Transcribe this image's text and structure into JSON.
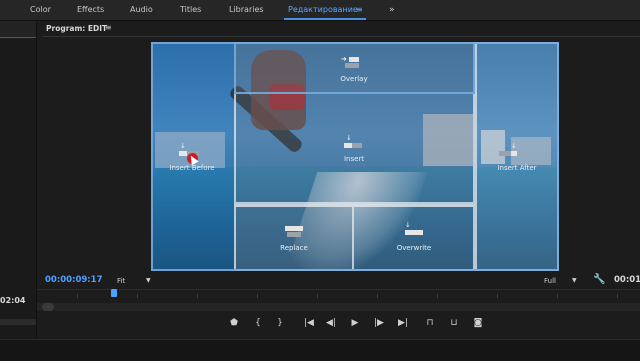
{
  "workspaces": {
    "tabs": [
      "Color",
      "Effects",
      "Audio",
      "Titles",
      "Libraries",
      "Редактирование"
    ],
    "active": "Редактирование",
    "menu_icon": "≡",
    "more_icon": "»"
  },
  "left_panel": {
    "timecode": "02:04",
    "add_icon": "+"
  },
  "program_monitor": {
    "title": "Program: EDIT",
    "menu_icon": "≡",
    "zones": {
      "overlay": "Overlay",
      "insert": "Insert",
      "insert_before": "Insert Before",
      "insert_after": "Insert After",
      "replace": "Replace",
      "overwrite": "Overwrite"
    },
    "current_timecode": "00:00:09:17",
    "fit": "Fit",
    "resolution": "Full",
    "duration_timecode": "00:01:",
    "chevron_icon": "▼",
    "settings_icon": "wrench-icon"
  },
  "transport": {
    "buttons": [
      {
        "name": "add-marker-button",
        "icon": "marker-icon",
        "glyph": "⬟"
      },
      {
        "name": "mark-in-button",
        "icon": "mark-in-icon",
        "glyph": "{"
      },
      {
        "name": "mark-out-button",
        "icon": "mark-out-icon",
        "glyph": "}"
      },
      {
        "name": "go-to-in-button",
        "icon": "go-to-in-icon",
        "glyph": "|◀"
      },
      {
        "name": "step-back-button",
        "icon": "step-back-icon",
        "glyph": "◀|"
      },
      {
        "name": "play-button",
        "icon": "play-icon",
        "glyph": "▶"
      },
      {
        "name": "step-forward-button",
        "icon": "step-forward-icon",
        "glyph": "|▶"
      },
      {
        "name": "go-to-out-button",
        "icon": "go-to-out-icon",
        "glyph": "▶|"
      },
      {
        "name": "lift-button",
        "icon": "lift-icon",
        "glyph": "⊓"
      },
      {
        "name": "extract-button",
        "icon": "extract-icon",
        "glyph": "⊔"
      },
      {
        "name": "export-frame-button",
        "icon": "camera-icon",
        "glyph": "◙"
      }
    ]
  },
  "colors": {
    "accent": "#4ea2ff",
    "background": "#1c1c1c",
    "cursor": "#d5171f"
  }
}
